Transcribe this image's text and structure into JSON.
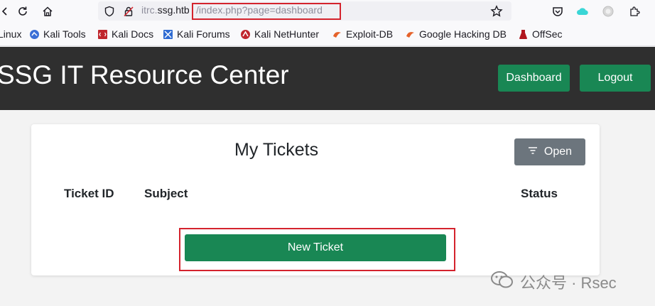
{
  "browser": {
    "url_host_prefix": "itrc.",
    "url_host_domain": "ssg.htb",
    "url_path": "/index.php?page=dashboard"
  },
  "bookmarks": [
    {
      "label": "Linux"
    },
    {
      "label": "Kali Tools"
    },
    {
      "label": "Kali Docs"
    },
    {
      "label": "Kali Forums"
    },
    {
      "label": "Kali NetHunter"
    },
    {
      "label": "Exploit-DB"
    },
    {
      "label": "Google Hacking DB"
    },
    {
      "label": "OffSec"
    }
  ],
  "header": {
    "title": "SSG IT Resource Center",
    "dashboard_label": "Dashboard",
    "logout_label": "Logout"
  },
  "tickets": {
    "title": "My Tickets",
    "filter_label": "Open",
    "columns": [
      "Ticket ID",
      "Subject",
      "Status"
    ],
    "new_ticket_label": "New Ticket"
  },
  "watermark": {
    "text": "公众号 · Rsec"
  },
  "colors": {
    "accent_green": "#198754",
    "header_bg": "#2f2f2f",
    "highlight_red": "#d4232d",
    "filter_gray": "#6c757d"
  }
}
